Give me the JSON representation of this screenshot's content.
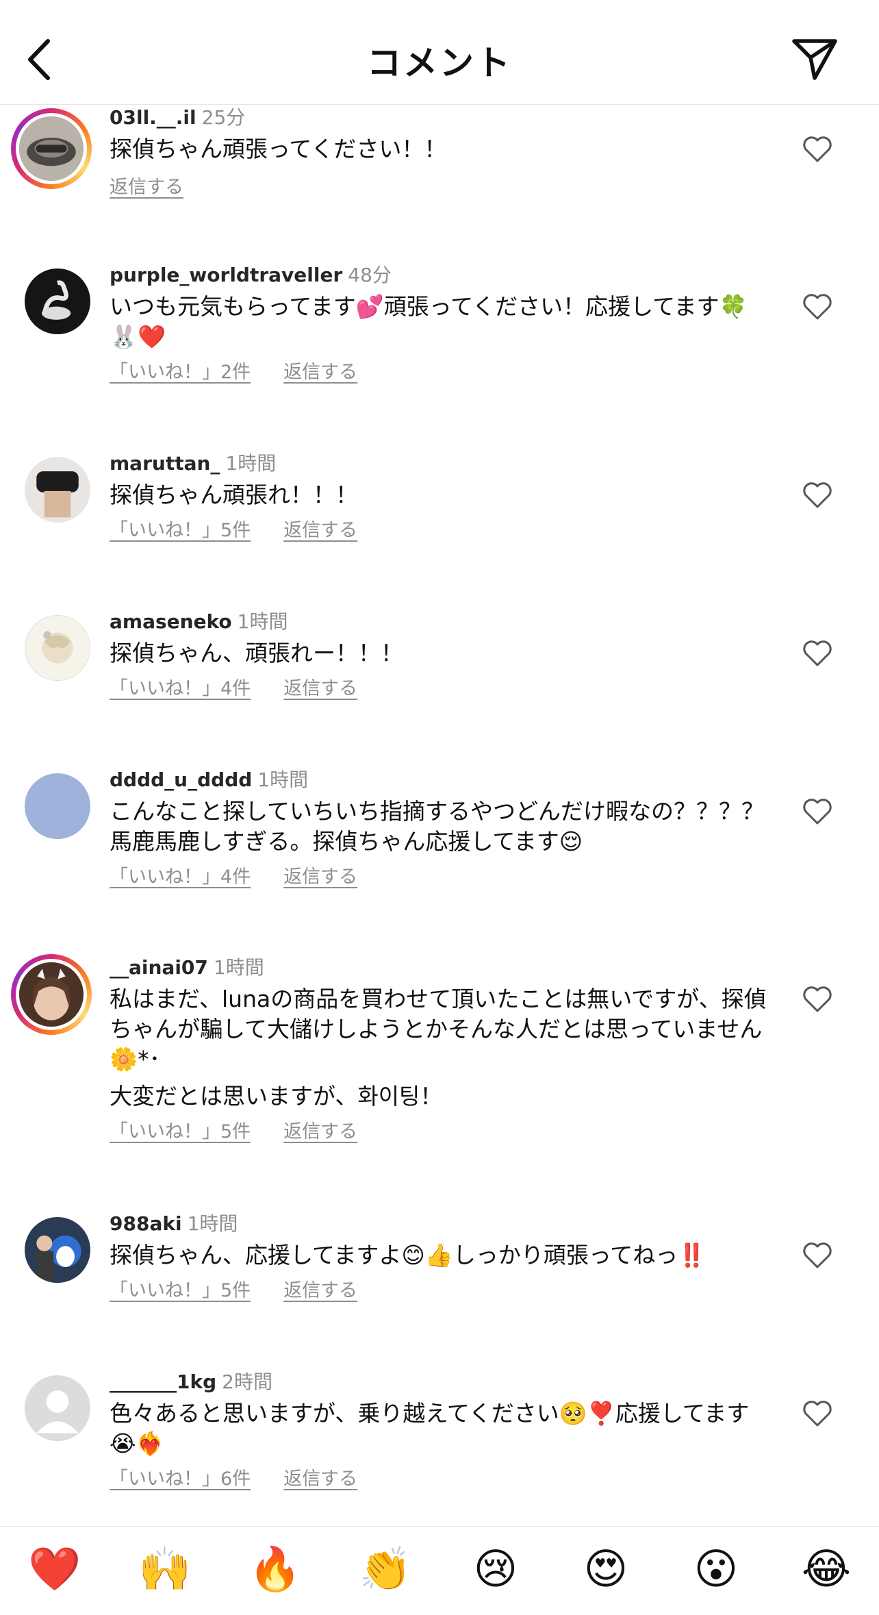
{
  "header": {
    "title": "コメント"
  },
  "comments": [
    {
      "username": "03ll.__.il",
      "time": "25分",
      "lines": [
        "探偵ちゃん頑張ってください！！"
      ],
      "likes": "",
      "reply": "返信する"
    },
    {
      "username": "purple_worldtraveller",
      "time": "48分",
      "lines": [
        "いつも元気もらってます💕頑張ってください！応援してます🍀🐰❤️"
      ],
      "likes": "「いいね！」2件",
      "reply": "返信する"
    },
    {
      "username": "maruttan_",
      "time": "1時間",
      "lines": [
        "探偵ちゃん頑張れ！！！"
      ],
      "likes": "「いいね！」5件",
      "reply": "返信する"
    },
    {
      "username": "amaseneko",
      "time": "1時間",
      "lines": [
        "探偵ちゃん、頑張れー！！！"
      ],
      "likes": "「いいね！」4件",
      "reply": "返信する"
    },
    {
      "username": "dddd_u_dddd",
      "time": "1時間",
      "lines": [
        "こんなこと探していちいち指摘するやつどんだけ暇なの？？？？馬鹿馬鹿しすぎる。探偵ちゃん応援してます😌"
      ],
      "likes": "「いいね！」4件",
      "reply": "返信する"
    },
    {
      "username": "__ainai07",
      "time": "1時間",
      "lines": [
        "私はまだ、lunaの商品を買わせて頂いたことは無いですが、探偵ちゃんが騙して大儲けしようとかそんな人だとは思っていません🌼*･",
        "大変だとは思いますが、화이팅！"
      ],
      "likes": "「いいね！」5件",
      "reply": "返信する"
    },
    {
      "username": "988aki",
      "time": "1時間",
      "lines": [
        "探偵ちゃん、応援してますよ😊👍しっかり頑張ってねっ‼️"
      ],
      "likes": "「いいね！」5件",
      "reply": "返信する"
    },
    {
      "username": "_______1kg",
      "time": "2時間",
      "lines": [
        "色々あると思いますが、乗り越えてください🥺❣️応援してます😭❤️‍🔥"
      ],
      "likes": "「いいね！」6件",
      "reply": "返信する"
    }
  ],
  "reactions": [
    "❤️",
    "🙌",
    "🔥",
    "👏",
    "😢",
    "😍",
    "😮",
    "😂"
  ]
}
